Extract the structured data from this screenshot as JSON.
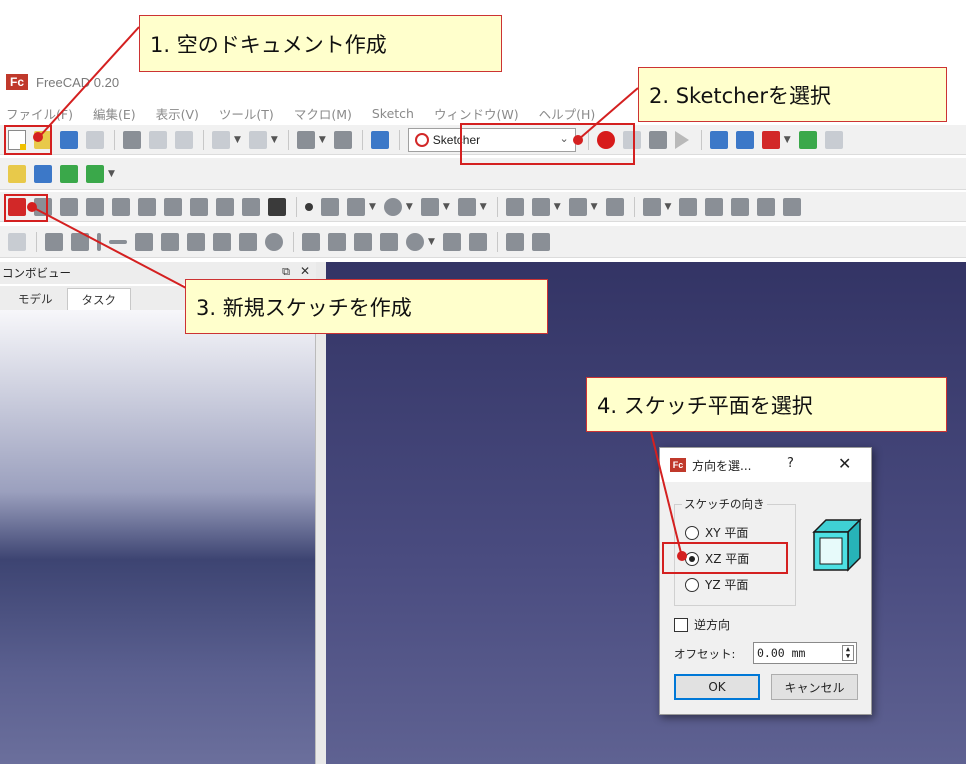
{
  "app": {
    "logo_text": "Fc",
    "title": "FreeCAD 0.20"
  },
  "menu": {
    "items": [
      "ファイル(F)",
      "編集(E)",
      "表示(V)",
      "ツール(T)",
      "マクロ(M)",
      "Sketch",
      "ウィンドウ(W)",
      "ヘルプ(H)"
    ]
  },
  "toolbar": {
    "workbench": "Sketcher"
  },
  "combo_view": {
    "title": "コンボビュー",
    "float_icon": "⧉",
    "close_icon": "✕",
    "tabs": [
      "モデル",
      "タスク"
    ]
  },
  "dialog": {
    "logo_text": "Fc",
    "title": "方向を選...",
    "help": "?",
    "close": "✕",
    "group_title": "スケッチの向き",
    "options": [
      "XY 平面",
      "XZ 平面",
      "YZ 平面"
    ],
    "selected_index": 1,
    "reverse_label": "逆方向",
    "offset_label": "オフセット:",
    "offset_value": "0.00 mm",
    "ok_label": "OK",
    "cancel_label": "キャンセル"
  },
  "callouts": {
    "step1": "1. 空のドキュメント作成",
    "step2": "2. Sketcherを選択",
    "step3": "3. 新規スケッチを作成",
    "step4": "4. スケッチ平面を選択"
  },
  "colors": {
    "callout_bg": "#ffffcc",
    "callout_border": "#cc3333",
    "highlight": "#d42020",
    "viewport_top": "#333465",
    "viewport_bottom": "#5f6292",
    "record_button": "#d71a1a"
  }
}
